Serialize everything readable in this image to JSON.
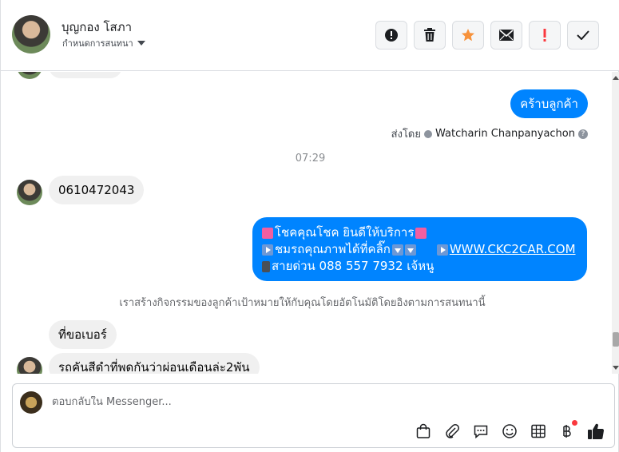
{
  "header": {
    "contact_name": "บุญกอง โสภา",
    "assign_label": "กำหนดการสนทนา",
    "toolbar": [
      {
        "name": "spam",
        "icon": "alert-circle-icon"
      },
      {
        "name": "delete",
        "icon": "trash-icon"
      },
      {
        "name": "star",
        "icon": "star-icon",
        "color": "#f7923b"
      },
      {
        "name": "mail",
        "icon": "envelope-icon"
      },
      {
        "name": "priority",
        "icon": "exclamation-icon",
        "color": "#fa383e"
      },
      {
        "name": "done",
        "icon": "check-icon"
      }
    ]
  },
  "messages": {
    "out_thanks": "คร้าบลูกค้า",
    "sent_by_prefix": "ส่งโดย",
    "sent_by_name": "Watcharin Chanpanyachon",
    "time": "07:29",
    "in_phone": "0610472043",
    "promo_line1": "โชคคุณโชค ยินดีให้บริการ",
    "promo_line2_text": "ชมรถคุณภาพได้ที่คลิ๊ก",
    "promo_link": "WWW.CKC2CAR.COM",
    "promo_line3": "สายด่วน 088 557 7932 เจ้หนู",
    "system_note": "เราสร้างกิจกรรมของลูกค้าเป้าหมายให้กับคุณโดยอัตโนมัติโดยอิงตามการสนทนานี้",
    "in_ask_number": "ที่ขอเบอร์",
    "in_black_car": "รถคันสีดำที่พดกันว่าผ่อนเดือนล่ะ2พัน"
  },
  "composer": {
    "placeholder": "ตอบกลับใน Messenger...",
    "tools": [
      "shopping-bag-icon",
      "paperclip-icon",
      "saved-reply-icon",
      "emoji-icon",
      "table-icon",
      "baht-icon",
      "thumbs-up-icon"
    ]
  },
  "colors": {
    "outgoing_bubble": "#0084ff",
    "incoming_bubble": "#f0f0f0",
    "star": "#f7923b",
    "priority": "#fa383e"
  }
}
